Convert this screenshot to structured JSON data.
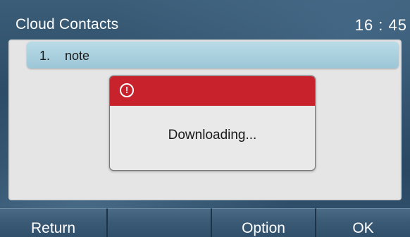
{
  "title_bar": {
    "title": "Cloud Contacts",
    "time": "16 : 45"
  },
  "list": {
    "items": [
      {
        "number": "1.",
        "label": "note"
      }
    ]
  },
  "dialog": {
    "icon": "alert-icon",
    "message": "Downloading...",
    "header_color": "#c8232c"
  },
  "softkeys": [
    {
      "label": "Return"
    },
    {
      "label": ""
    },
    {
      "label": "Option"
    },
    {
      "label": "OK"
    }
  ],
  "colors": {
    "background": "#2c4a63",
    "selected_item": "#a9d0de",
    "panel": "#e5e5e5"
  }
}
